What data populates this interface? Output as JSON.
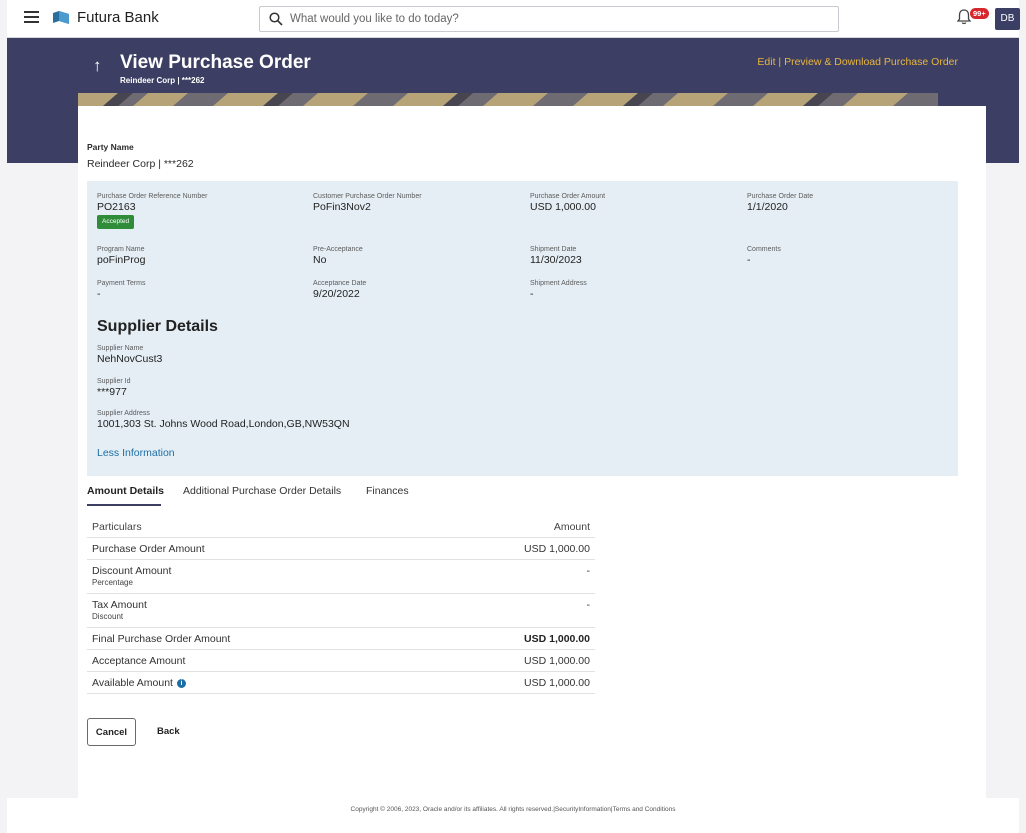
{
  "header": {
    "brand": "Futura Bank",
    "search_placeholder": "What would you like to do today?",
    "notification_count": "99+",
    "user_initials": "DB"
  },
  "page": {
    "title": "View Purchase Order",
    "subtitle": "Reindeer Corp | ***262",
    "edit_link": "Edit",
    "separator": "|",
    "download_link": "Preview & Download Purchase Order"
  },
  "party": {
    "label": "Party Name",
    "value": "Reindeer Corp | ***262"
  },
  "details": {
    "po_ref_label": "Purchase Order Reference Number",
    "po_ref_value": "PO2163",
    "status": "Accepted",
    "customer_po_label": "Customer Purchase Order Number",
    "customer_po_value": "PoFin3Nov2",
    "po_amount_label": "Purchase Order Amount",
    "po_amount_value": "USD 1,000.00",
    "po_date_label": "Purchase Order Date",
    "po_date_value": "1/1/2020",
    "program_label": "Program Name",
    "program_value": "poFinProg",
    "pre_accept_label": "Pre-Acceptance",
    "pre_accept_value": "No",
    "shipment_date_label": "Shipment Date",
    "shipment_date_value": "11/30/2023",
    "comments_label": "Comments",
    "comments_value": "-",
    "payment_terms_label": "Payment Terms",
    "payment_terms_value": "-",
    "acceptance_date_label": "Acceptance Date",
    "acceptance_date_value": "9/20/2022",
    "shipment_address_label": "Shipment Address",
    "shipment_address_value": "-"
  },
  "supplier": {
    "heading": "Supplier Details",
    "name_label": "Supplier Name",
    "name_value": "NehNovCust3",
    "id_label": "Supplier Id",
    "id_value": "***977",
    "address_label": "Supplier Address",
    "address_value": "1001,303 St. Johns Wood Road,London,GB,NW53QN",
    "less_link": "Less Information"
  },
  "tabs": [
    {
      "label": "Amount Details",
      "active": true
    },
    {
      "label": "Additional Purchase Order Details",
      "active": false
    },
    {
      "label": "Finances",
      "active": false
    }
  ],
  "amount_table": {
    "col_particulars": "Particulars",
    "col_amount": "Amount",
    "rows": [
      {
        "label": "Purchase Order Amount",
        "sub": "",
        "amount": "USD 1,000.00"
      },
      {
        "label": "Discount Amount",
        "sub": "Percentage",
        "amount": "-"
      },
      {
        "label": "Tax Amount",
        "sub": "Discount",
        "amount": "-"
      },
      {
        "label": "Final Purchase Order Amount",
        "sub": "",
        "amount": "USD 1,000.00"
      },
      {
        "label": "Acceptance Amount",
        "sub": "",
        "amount": "USD 1,000.00"
      },
      {
        "label": "Available Amount",
        "sub": "",
        "amount": "USD 1,000.00"
      }
    ]
  },
  "buttons": {
    "cancel": "Cancel",
    "back": "Back"
  },
  "footer": {
    "copyright": "Copyright © 2006, 2023, Oracle and/or its affiliates. All rights reserved.|SecurityInformation|Terms and Conditions"
  },
  "colors": {
    "banner": "#3c3f63",
    "accent_link": "#e8b53e",
    "info_panel": "#e4eef4",
    "status_green": "#2f8c39",
    "link_blue": "#1c6fa6"
  }
}
